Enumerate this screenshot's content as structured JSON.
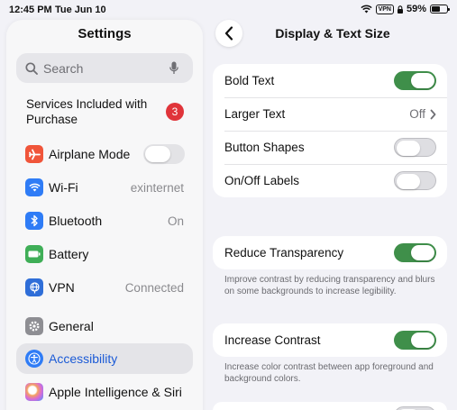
{
  "status_bar": {
    "time": "12:45 PM",
    "date": "Tue Jun 10",
    "vpn": "VPN",
    "battery": "59%",
    "battery_level": 0.59
  },
  "sidebar": {
    "title": "Settings",
    "search_placeholder": "Search",
    "services_label": "Services Included with Purchase",
    "services_badge": "3",
    "items": [
      {
        "label": "Airplane Mode",
        "icon": "airplane-icon",
        "color": "#f0553a",
        "toggle": false
      },
      {
        "label": "Wi-Fi",
        "icon": "wifi-icon",
        "color": "#2f7cf6",
        "value": "exinternet"
      },
      {
        "label": "Bluetooth",
        "icon": "bluetooth-icon",
        "color": "#2f7cf6",
        "value": "On"
      },
      {
        "label": "Battery",
        "icon": "battery-icon",
        "color": "#3fae57"
      },
      {
        "label": "VPN",
        "icon": "vpn-icon",
        "color": "#2f6ed8",
        "value": "Connected"
      },
      {
        "label": "General",
        "icon": "gear-icon",
        "color": "#8e8e93"
      },
      {
        "label": "Accessibility",
        "icon": "accessibility-icon",
        "color": "#2f7cf6",
        "selected": true
      },
      {
        "label": "Apple Intelligence & Siri",
        "icon": "siri-icon",
        "color": "#d86ad8"
      }
    ]
  },
  "detail": {
    "title": "Display & Text Size",
    "group1": [
      {
        "label": "Bold Text",
        "toggle": true
      },
      {
        "label": "Larger Text",
        "value": "Off"
      },
      {
        "label": "Button Shapes",
        "toggle": false
      },
      {
        "label": "On/Off Labels",
        "toggle": false
      }
    ],
    "reduce_transparency": {
      "label": "Reduce Transparency",
      "toggle": true,
      "footnote": "Improve contrast by reducing transparency and blurs on some backgrounds to increase legibility."
    },
    "increase_contrast": {
      "label": "Increase Contrast",
      "toggle": true,
      "footnote": "Increase color contrast between app foreground and background colors."
    }
  },
  "colors": {
    "toggle_on": "#3f8f4a",
    "accent": "#1c5bd6",
    "badge": "#e0343a"
  }
}
